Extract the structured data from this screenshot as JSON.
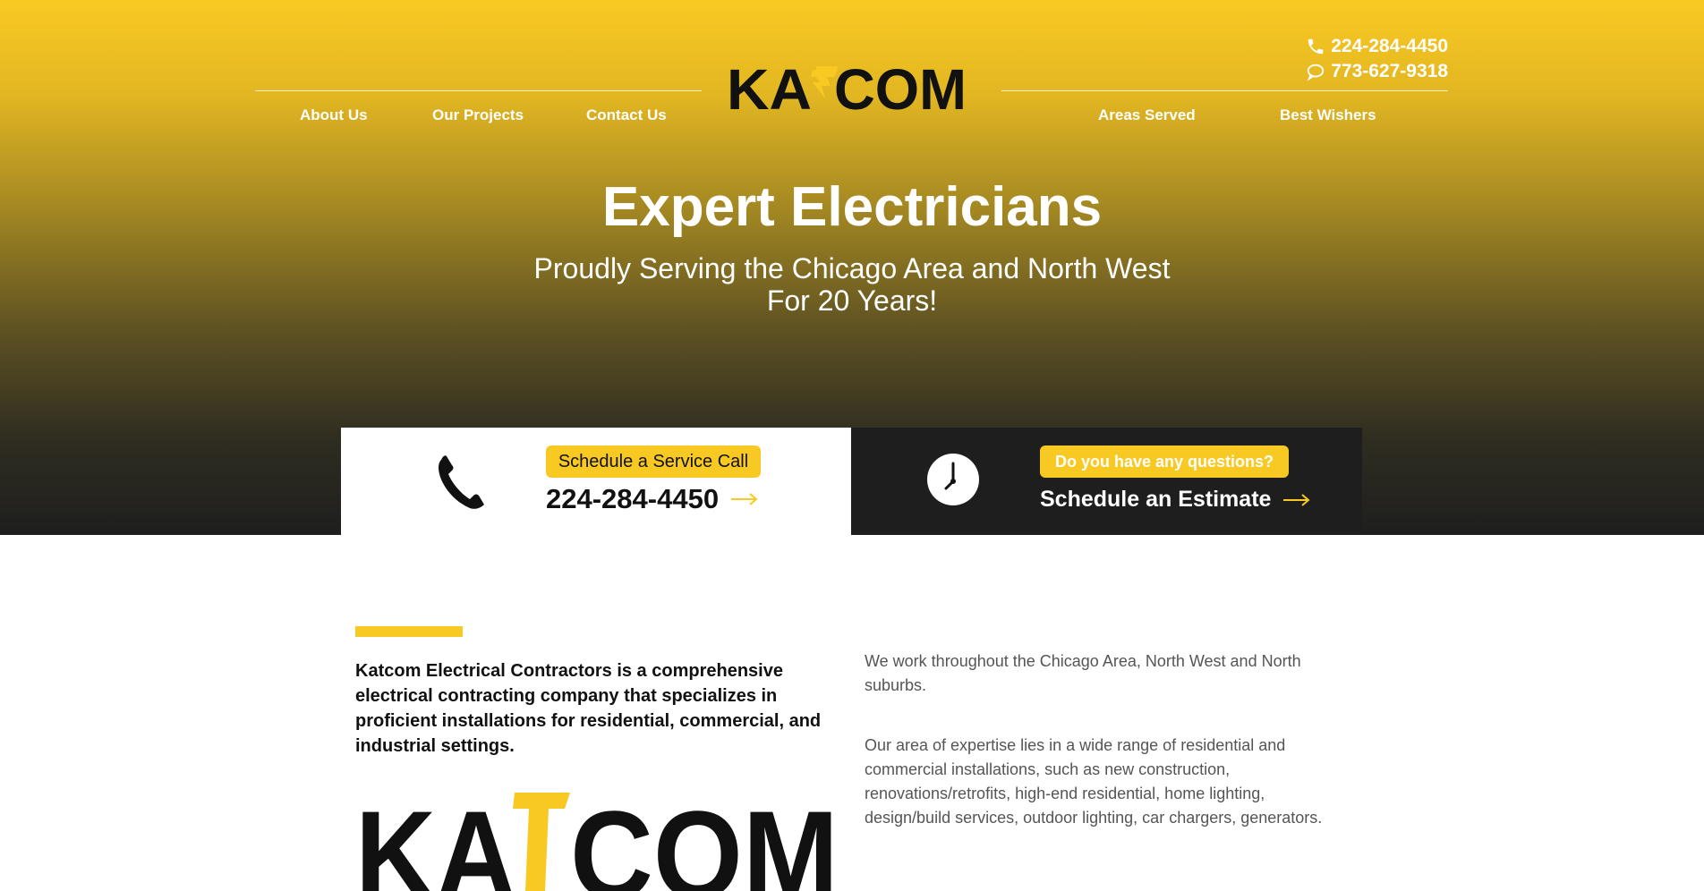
{
  "header": {
    "logo_text": "KATCOM",
    "phone_primary": "224-284-4450",
    "phone_secondary": "773-627-9318",
    "nav_left": [
      "About Us",
      "Our Projects",
      "Contact Us"
    ],
    "nav_right": [
      "Areas Served",
      "Best Wishers"
    ]
  },
  "hero": {
    "title": "Expert Electricians",
    "subtitle_line1": "Proudly Serving the Chicago Area and North West",
    "subtitle_line2": "For 20 Years!"
  },
  "cta": {
    "service_label": "Schedule a Service Call",
    "service_phone": "224-284-4450",
    "questions_label": "Do you have any questions?",
    "estimate_label": "Schedule an Estimate"
  },
  "about": {
    "intro": "Katcom Electrical Contractors is a comprehensive electrical contracting company that specializes in proficient installations for residential, commercial, and industrial settings.",
    "para1": "We work throughout the Chicago Area, North West and North suburbs.",
    "para2": "Our area of expertise lies in a wide range of residential and commercial installations, such as new construction, renovations/retrofits, high-end residential, home lighting, design/build services, outdoor lighting, car chargers, generators."
  },
  "colors": {
    "accent": "#f9c923",
    "dark": "#1e1e1e",
    "text_muted": "#555555"
  }
}
